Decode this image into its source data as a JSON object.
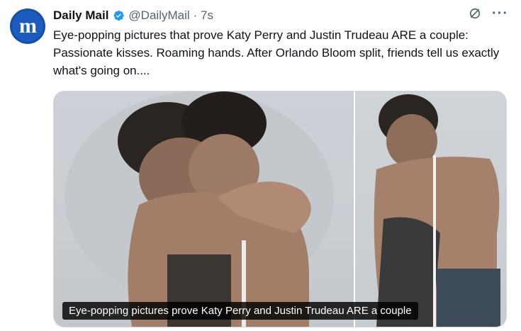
{
  "author": {
    "name": "Daily Mail",
    "handle": "@DailyMail",
    "time": "· 7s",
    "avatar_letter": "m",
    "avatar_color": "#1d5cbf",
    "verified_color": "#1d9bf0"
  },
  "tweet": {
    "text": "Eye-popping pictures that prove Katy Perry and Justin Trudeau ARE a couple: Passionate kisses. Roaming hands. After Orlando Bloom split, friends tell us exactly what's going on...."
  },
  "media": {
    "caption": "Eye-popping pictures prove Katy Perry and Justin Trudeau ARE a couple"
  },
  "icons": {
    "verified": "verified-badge-icon",
    "grok": "grok-icon",
    "more": "more-icon"
  }
}
